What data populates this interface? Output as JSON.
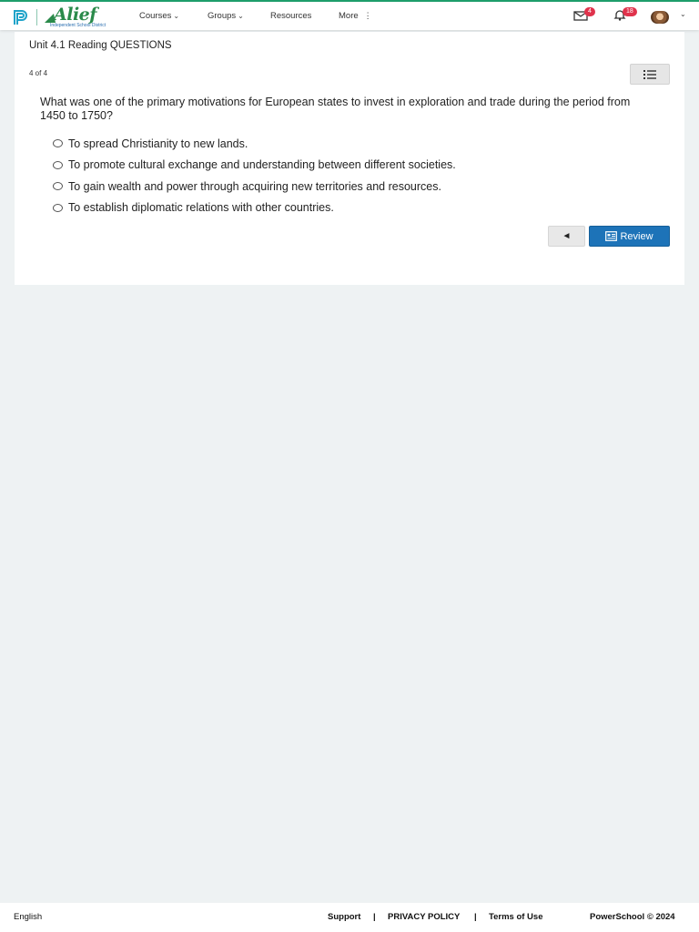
{
  "header": {
    "district": {
      "name": "Alief",
      "subtitle": "Independent School District"
    },
    "nav": [
      {
        "label": "Courses",
        "icon": "chevron-down-icon"
      },
      {
        "label": "Groups",
        "icon": "chevron-down-icon"
      },
      {
        "label": "Resources"
      },
      {
        "label": "More",
        "icon": "vertical-dots-icon"
      }
    ],
    "mail_count": "4",
    "notification_count": "18"
  },
  "assessment": {
    "title": "Unit 4.1 Reading QUESTIONS",
    "progress": "4 of 4",
    "question": "What was one of the primary motivations for European states to invest in exploration and trade during the period from 1450 to 1750?",
    "options": [
      "To spread Christianity to new lands.",
      "To promote cultural exchange and understanding between different societies.",
      "To gain wealth and power through acquiring new territories and resources.",
      "To establish diplomatic relations with other countries."
    ],
    "prev_symbol": "◄",
    "review_label": "Review"
  },
  "footer": {
    "language": "English",
    "links": [
      "Support",
      "PRIVACY POLICY",
      "Terms of Use"
    ],
    "separator": "|",
    "copyright": "PowerSchool © 2024"
  },
  "colors": {
    "brand_green": "#2a8a4a",
    "accent_blue": "#1d73b8",
    "badge_red": "#e0334c",
    "page_background": "#eef2f3"
  }
}
